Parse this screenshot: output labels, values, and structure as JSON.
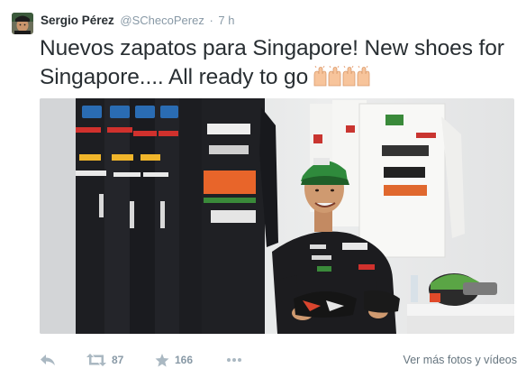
{
  "tweet": {
    "display_name": "Sergio Pérez",
    "screen_name": "@SChecoPerez",
    "separator": "·",
    "timestamp": "7 h",
    "text": "Nuevos zapatos para Singapore! New shoes for Singapore.... All ready to go",
    "emoji": "clapping-hands-x4"
  },
  "actions": {
    "retweet_count": "87",
    "favorite_count": "166",
    "more_photos_label": "Ver más fotos y vídeos"
  },
  "colors": {
    "text": "#292f33",
    "muted": "#8899a6",
    "link": "#66757f"
  }
}
